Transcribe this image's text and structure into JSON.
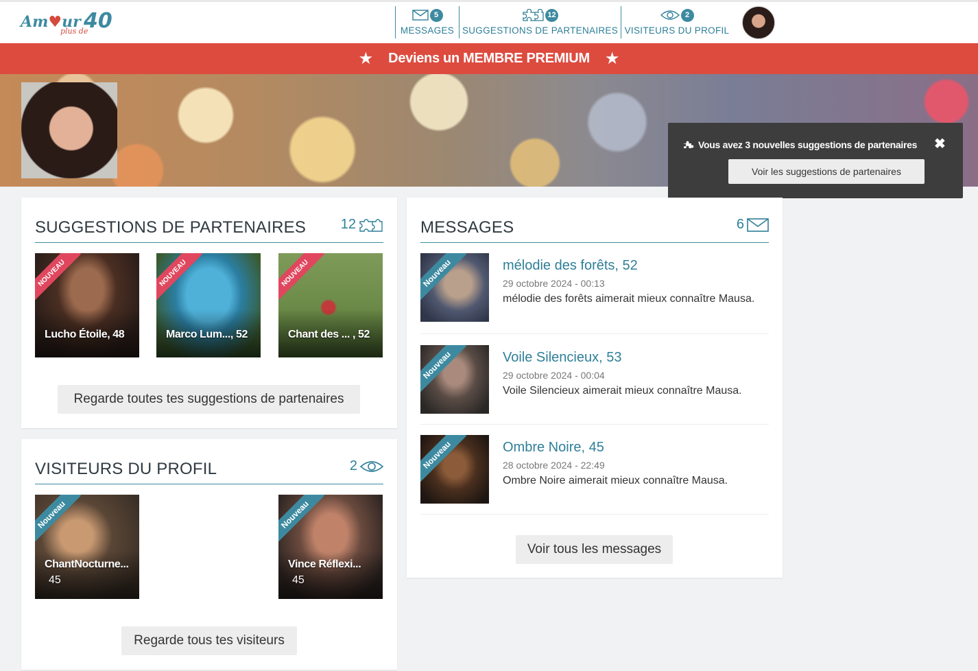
{
  "header": {
    "logo": {
      "word1_a": "Am",
      "word1_b": "ur",
      "word2": "plus de",
      "number": "40"
    },
    "nav": [
      {
        "label": "MESSAGES",
        "count": "5",
        "icon": "envelope-icon"
      },
      {
        "label": "SUGGESTIONS DE PARTENAIRES",
        "count": "12",
        "icon": "puzzle-icon"
      },
      {
        "label": "VISITEURS DU PROFIL",
        "count": "2",
        "icon": "eye-icon"
      }
    ]
  },
  "premium": {
    "label": "Deviens un MEMBRE PREMIUM"
  },
  "toast": {
    "message": "Vous avez 3 nouvelles suggestions de partenaires",
    "button": "Voir les suggestions de partenaires"
  },
  "suggestions": {
    "title": "SUGGESTIONS DE PARTENAIRES",
    "count": "12",
    "items": [
      {
        "name": "Lucho Étoile, 48",
        "badge": "NOUVEAU"
      },
      {
        "name": "Marco Lum..., 52",
        "badge": "NOUVEAU"
      },
      {
        "name": "Chant des ... , 52",
        "badge": "NOUVEAU"
      }
    ],
    "button": "Regarde toutes tes suggestions de partenaires"
  },
  "visitors": {
    "title": "VISITEURS DU PROFIL",
    "count": "2",
    "items": [
      {
        "name": "ChantNocturne...",
        "age": "45",
        "badge": "Nouveau"
      },
      {
        "name": "Vince Réflexi...",
        "age": "45",
        "badge": "Nouveau"
      }
    ],
    "button": "Regarde tous tes visiteurs"
  },
  "messages": {
    "title": "MESSAGES",
    "count": "6",
    "items": [
      {
        "name": "mélodie des forêts, 52",
        "date": "29 octobre 2024 - 00:13",
        "text": "mélodie des forêts aimerait mieux connaître Mausa.",
        "badge": "Nouveau"
      },
      {
        "name": "Voile Silencieux, 53",
        "date": "29 octobre 2024 - 00:04",
        "text": "Voile Silencieux aimerait mieux connaître Mausa.",
        "badge": "Nouveau"
      },
      {
        "name": "Ombre Noire, 45",
        "date": "28 octobre 2024 - 22:49",
        "text": "Ombre Noire aimerait mieux connaître Mausa.",
        "badge": "Nouveau"
      }
    ],
    "button": "Voir tous les messages"
  },
  "colors": {
    "accent": "#3d8aa0",
    "premium": "#dd4b3f",
    "ribbon_red": "#e0475e"
  }
}
